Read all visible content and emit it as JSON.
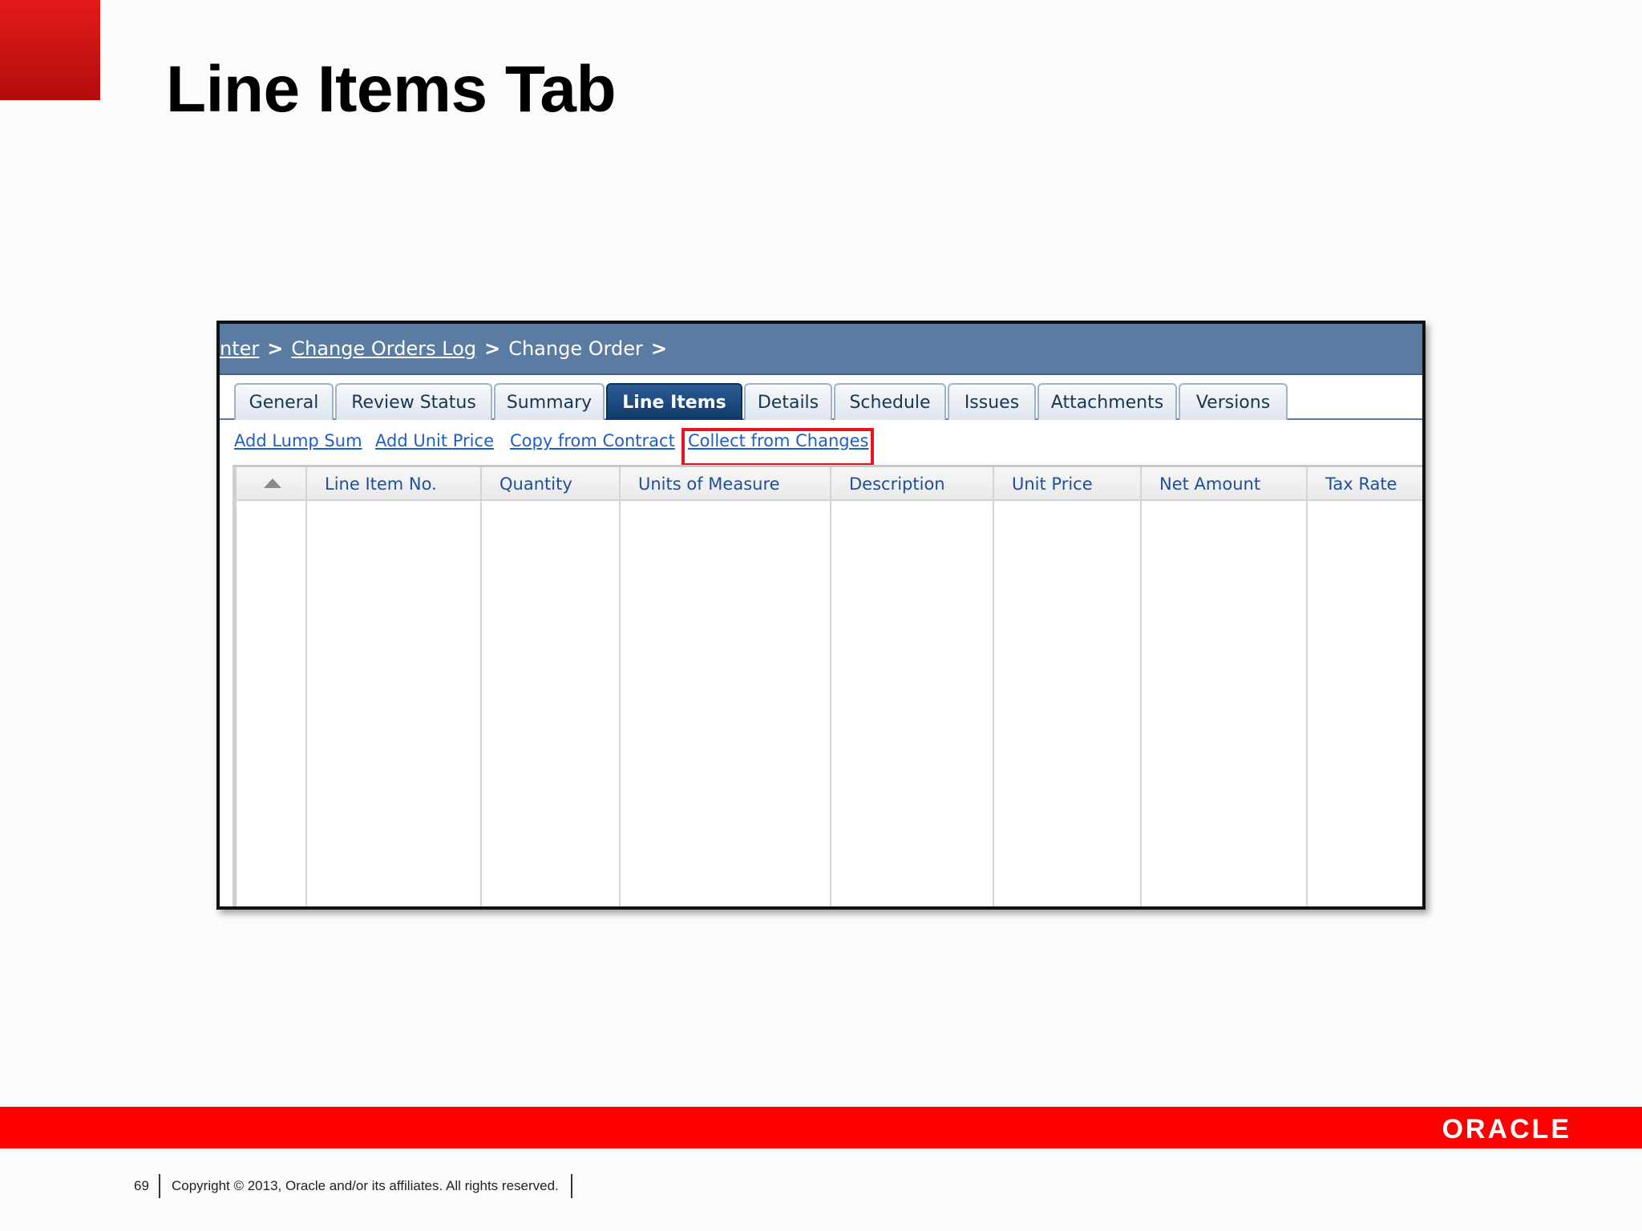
{
  "slide": {
    "title": "Line Items Tab",
    "page_number": "69",
    "copyright": "Copyright © 2013, Oracle and/or its affiliates. All rights reserved.",
    "logo_text": "ORACLE",
    "brand_color": "#ff0000"
  },
  "breadcrumb": {
    "items": [
      {
        "label": "nter",
        "link": true
      },
      {
        "label": "Change Orders Log",
        "link": true
      },
      {
        "label": "Change Order",
        "link": false
      }
    ],
    "separator": ">"
  },
  "tabs": [
    {
      "label": "General",
      "active": false
    },
    {
      "label": "Review Status",
      "active": false
    },
    {
      "label": "Summary",
      "active": false
    },
    {
      "label": "Line Items",
      "active": true
    },
    {
      "label": "Details",
      "active": false
    },
    {
      "label": "Schedule",
      "active": false
    },
    {
      "label": "Issues",
      "active": false
    },
    {
      "label": "Attachments",
      "active": false
    },
    {
      "label": "Versions",
      "active": false
    }
  ],
  "actions": [
    {
      "label": "Add Lump Sum"
    },
    {
      "label": "Add Unit Price"
    },
    {
      "label": "Copy from Contract"
    },
    {
      "label": "Collect from Changes",
      "highlighted": true
    }
  ],
  "highlight_color": "#e8131f",
  "table": {
    "sort_icon": "sort-ascending-icon",
    "columns": [
      "Line Item No.",
      "Quantity",
      "Units of Measure",
      "Description",
      "Unit Price",
      "Net Amount",
      "Tax Rate"
    ],
    "rows": []
  }
}
